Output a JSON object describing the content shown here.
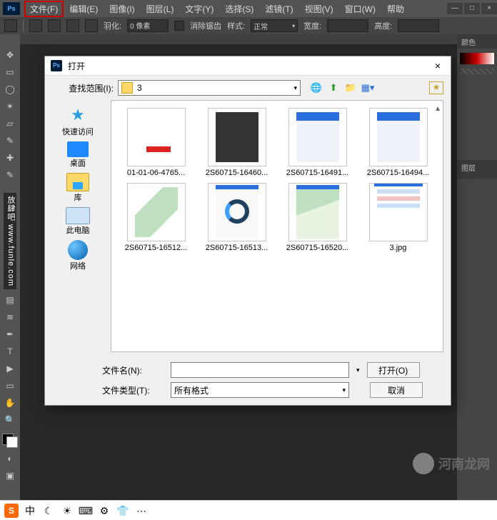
{
  "app_logo": "Ps",
  "menus": [
    "文件(F)",
    "编辑(E)",
    "图像(I)",
    "图层(L)",
    "文字(Y)",
    "选择(S)",
    "滤镜(T)",
    "视图(V)",
    "窗口(W)",
    "帮助"
  ],
  "highlighted_menu_index": 0,
  "window_controls": {
    "min": "—",
    "max": "□",
    "close": "×"
  },
  "option_bar": {
    "feather_label": "羽化:",
    "feather_value": "0 像素",
    "antialias_label": "消除锯齿",
    "style_label": "样式:",
    "style_value": "正常",
    "width_label": "宽度:",
    "height_label": "高度:"
  },
  "tools": [
    "↔",
    "▭",
    "○",
    "✎",
    "▱",
    "✂",
    "✎",
    "✎",
    "●",
    "▤",
    "≡",
    "T",
    "▶",
    "▭",
    "✋",
    "🔍"
  ],
  "vertical_text": "放肆吧  www.funle.com",
  "right_panel": {
    "top_tab": "颜色",
    "layers_tab": "图层"
  },
  "dialog": {
    "title": "打开",
    "look_in_label": "查找范围(I):",
    "look_in_value": "3",
    "toolbar_icons": [
      "globe",
      "up",
      "new",
      "view",
      "help"
    ],
    "places": [
      {
        "id": "quick",
        "label": "快速访问"
      },
      {
        "id": "desktop",
        "label": "桌面"
      },
      {
        "id": "libraries",
        "label": "库"
      },
      {
        "id": "thispc",
        "label": "此电脑"
      },
      {
        "id": "network",
        "label": "网络"
      }
    ],
    "files": [
      {
        "name": "01-01-06-4765...",
        "thumb": "t1"
      },
      {
        "name": "2S60715-16460...",
        "thumb": "t2"
      },
      {
        "name": "2S60715-16491...",
        "thumb": "t3"
      },
      {
        "name": "2S60715-16494...",
        "thumb": "t4"
      },
      {
        "name": "2S60715-16512...",
        "thumb": "t5"
      },
      {
        "name": "2S60715-16513...",
        "thumb": "t6"
      },
      {
        "name": "2S60715-16520...",
        "thumb": "t7"
      },
      {
        "name": "3.jpg",
        "thumb": "t8"
      }
    ],
    "file_name_label": "文件名(N):",
    "file_name_value": "",
    "file_type_label": "文件类型(T):",
    "file_type_value": "所有格式",
    "open_btn": "打开(O)",
    "cancel_btn": "取消"
  },
  "taskbar": {
    "items": [
      "S",
      "中",
      "☾",
      "☀",
      "⌨",
      "⚙",
      "👕",
      "⋯"
    ]
  },
  "watermark": "河南龙网"
}
